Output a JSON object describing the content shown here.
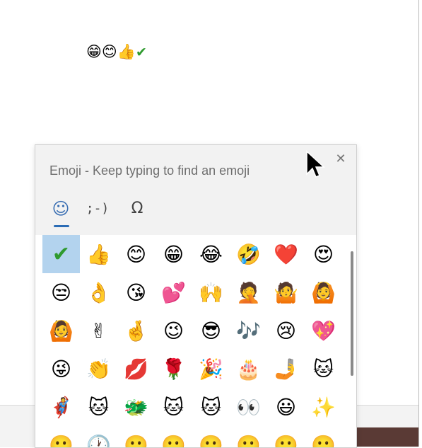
{
  "document": {
    "typed_emojis": [
      "😁",
      "😊",
      "👍",
      "✔"
    ]
  },
  "emoji_panel": {
    "title": "Emoji - Keep typing to find an emoji",
    "close_glyph": "✕",
    "tabs": [
      {
        "label": "☺",
        "name": "emoji"
      },
      {
        "label": ";-)",
        "name": "kaomoji"
      },
      {
        "label": "Ω",
        "name": "symbols"
      }
    ],
    "selected_emoji": "✔",
    "grid": [
      [
        "✔",
        "👍",
        "😊",
        "😁",
        "😂",
        "🤣",
        "❤️",
        "😍"
      ],
      [
        "😒",
        "👌",
        "😘",
        "💕",
        "🙌",
        "🤦",
        "🤷",
        "🙆"
      ],
      [
        "🙆",
        "✌",
        "🤞",
        "😉",
        "😎",
        "🎶",
        "😢",
        "💖"
      ],
      [
        "😜",
        "👏",
        "💋",
        "🌹",
        "🎉",
        "🎂",
        "🤳",
        "🐱"
      ],
      [
        "🦸",
        "🐱",
        "🐲",
        "🐱",
        "🐱",
        "👀",
        "😃",
        "✨"
      ],
      [
        "🙂",
        "🕐",
        "🙂",
        "🙂",
        "🙂",
        "🙂",
        "🙂",
        "🙂"
      ]
    ]
  }
}
